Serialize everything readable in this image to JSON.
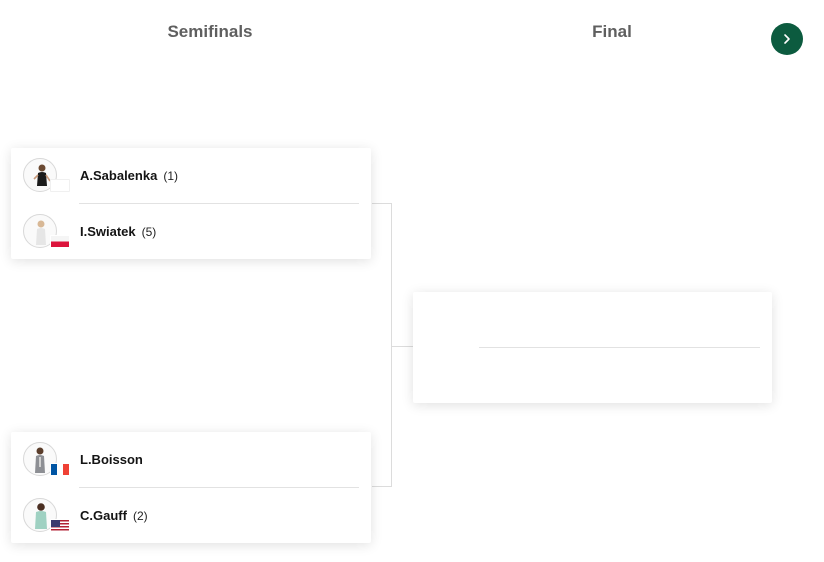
{
  "rounds": {
    "semifinals": "Semifinals",
    "final": "Final"
  },
  "next_button": {
    "icon": "chevron-right-icon",
    "color": "#0c5b3f"
  },
  "matches": {
    "sf1": {
      "players": [
        {
          "name": "A.Sabalenka",
          "seed": "(1)",
          "flag": "blank"
        },
        {
          "name": "I.Swiatek",
          "seed": "(5)",
          "flag": "poland-flag"
        }
      ]
    },
    "sf2": {
      "players": [
        {
          "name": "L.Boisson",
          "seed": "",
          "flag": "france-flag"
        },
        {
          "name": "C.Gauff",
          "seed": "(2)",
          "flag": "usa-flag"
        }
      ]
    },
    "final": {
      "players": [
        {
          "name": "",
          "seed": ""
        },
        {
          "name": "",
          "seed": ""
        }
      ]
    }
  }
}
